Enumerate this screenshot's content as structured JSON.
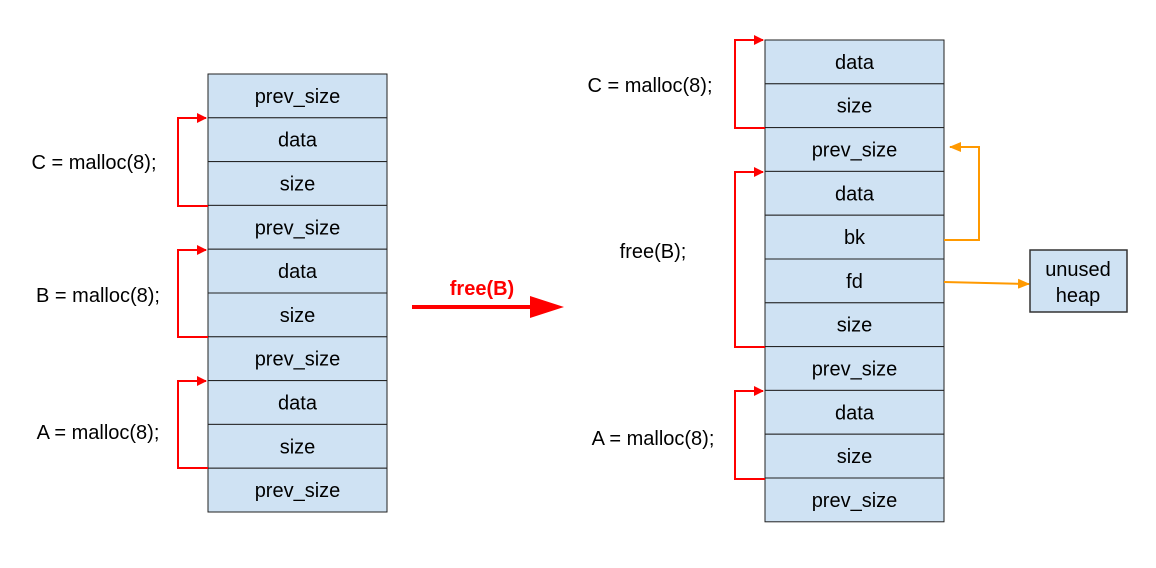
{
  "colors": {
    "cell_fill": "#cfe2f3",
    "cell_stroke": "#222222",
    "bracket": "#ff0000",
    "pointer": "#ff9900",
    "label": "#000000"
  },
  "left_stack": {
    "cells": [
      "prev_size",
      "data",
      "size",
      "prev_size",
      "data",
      "size",
      "prev_size",
      "data",
      "size",
      "prev_size"
    ],
    "labels": [
      "C = malloc(8);",
      "B = malloc(8);",
      "A = malloc(8);"
    ]
  },
  "transition": {
    "label": "free(B)"
  },
  "right_stack": {
    "cells": [
      "data",
      "size",
      "prev_size",
      "data",
      "bk",
      "fd",
      "size",
      "prev_size",
      "data",
      "size",
      "prev_size"
    ],
    "labels": [
      "C = malloc(8);",
      "free(B);",
      "A = malloc(8);"
    ]
  },
  "unused_heap": {
    "line1": "unused",
    "line2": "heap"
  }
}
